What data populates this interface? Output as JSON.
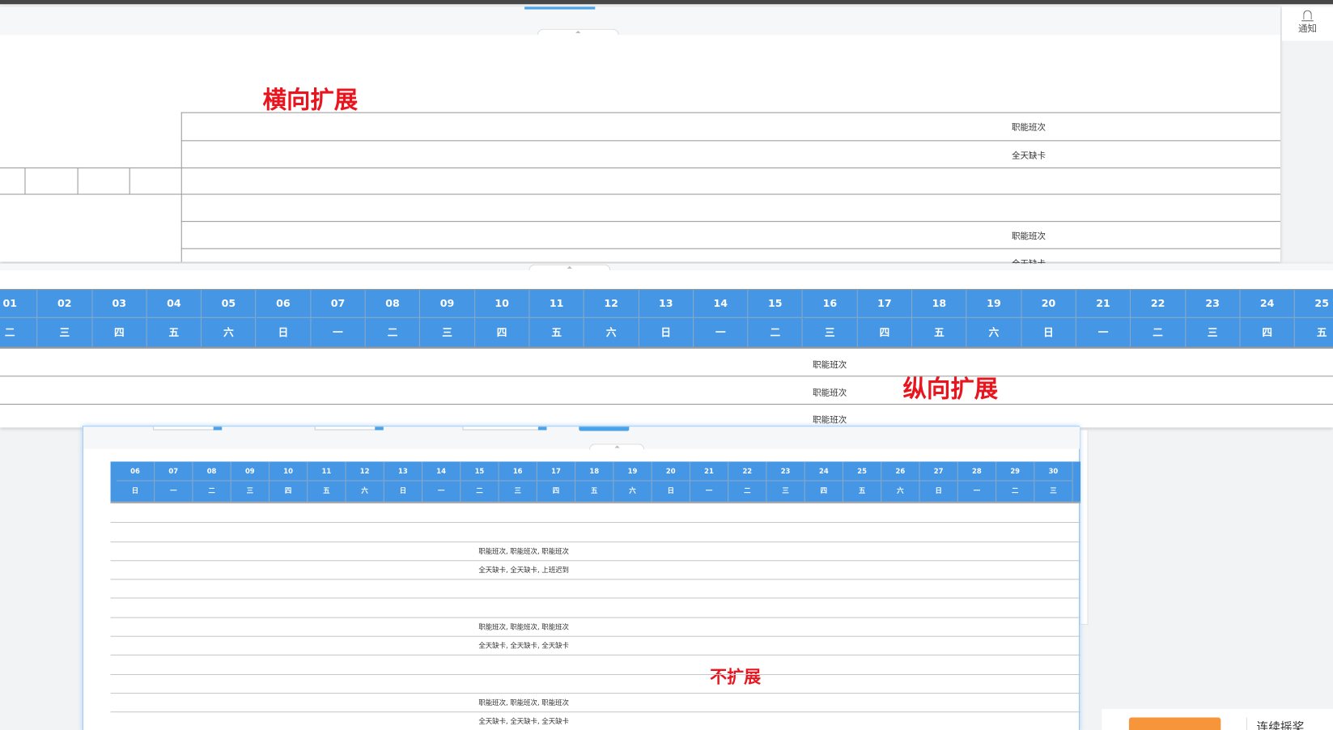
{
  "notification": {
    "label": "通知"
  },
  "annotations": {
    "horizontal": "横向扩展",
    "vertical": "纵向扩展",
    "none": "不扩展"
  },
  "panel_horizontal": {
    "rows": [
      "职能班次",
      "全天缺卡",
      "",
      "",
      "职能班次",
      "全天缺卡"
    ]
  },
  "panel_vertical": {
    "days": [
      "01",
      "02",
      "03",
      "04",
      "05",
      "06",
      "07",
      "08",
      "09",
      "10",
      "11",
      "12",
      "13",
      "14",
      "15",
      "16",
      "17",
      "18",
      "19",
      "20",
      "21",
      "22",
      "23",
      "24",
      "25"
    ],
    "weekdays": [
      "二",
      "三",
      "四",
      "五",
      "六",
      "日",
      "一",
      "二",
      "三",
      "四",
      "五",
      "六",
      "日",
      "一",
      "二",
      "三",
      "四",
      "五",
      "六",
      "日",
      "一",
      "二",
      "三",
      "四",
      "五"
    ],
    "rows": [
      "职能班次",
      "职能班次",
      "职能班次"
    ]
  },
  "panel_none": {
    "days": [
      "06",
      "07",
      "08",
      "09",
      "10",
      "11",
      "12",
      "13",
      "14",
      "15",
      "16",
      "17",
      "18",
      "19",
      "20",
      "21",
      "22",
      "23",
      "24",
      "25",
      "26",
      "27",
      "28",
      "29",
      "30"
    ],
    "weekdays": [
      "日",
      "一",
      "二",
      "三",
      "四",
      "五",
      "六",
      "日",
      "一",
      "二",
      "三",
      "四",
      "五",
      "六",
      "日",
      "一",
      "二",
      "三",
      "四",
      "五",
      "六",
      "日",
      "一",
      "二",
      "三"
    ],
    "rows": [
      "",
      "",
      "职能班次, 职能班次, 职能班次",
      "全天缺卡, 全天缺卡, 上班迟到",
      "",
      "",
      "职能班次, 职能班次, 职能班次",
      "全天缺卡, 全天缺卡, 全天缺卡",
      "",
      "",
      "职能班次, 职能班次, 职能班次",
      "全天缺卡, 全天缺卡, 全天缺卡"
    ]
  },
  "bottom_widget": {
    "label": "连续摇奖"
  },
  "colors": {
    "header_blue": "#4596e4",
    "annotation_red": "#e8141e",
    "button_orange": "#f7953b"
  }
}
